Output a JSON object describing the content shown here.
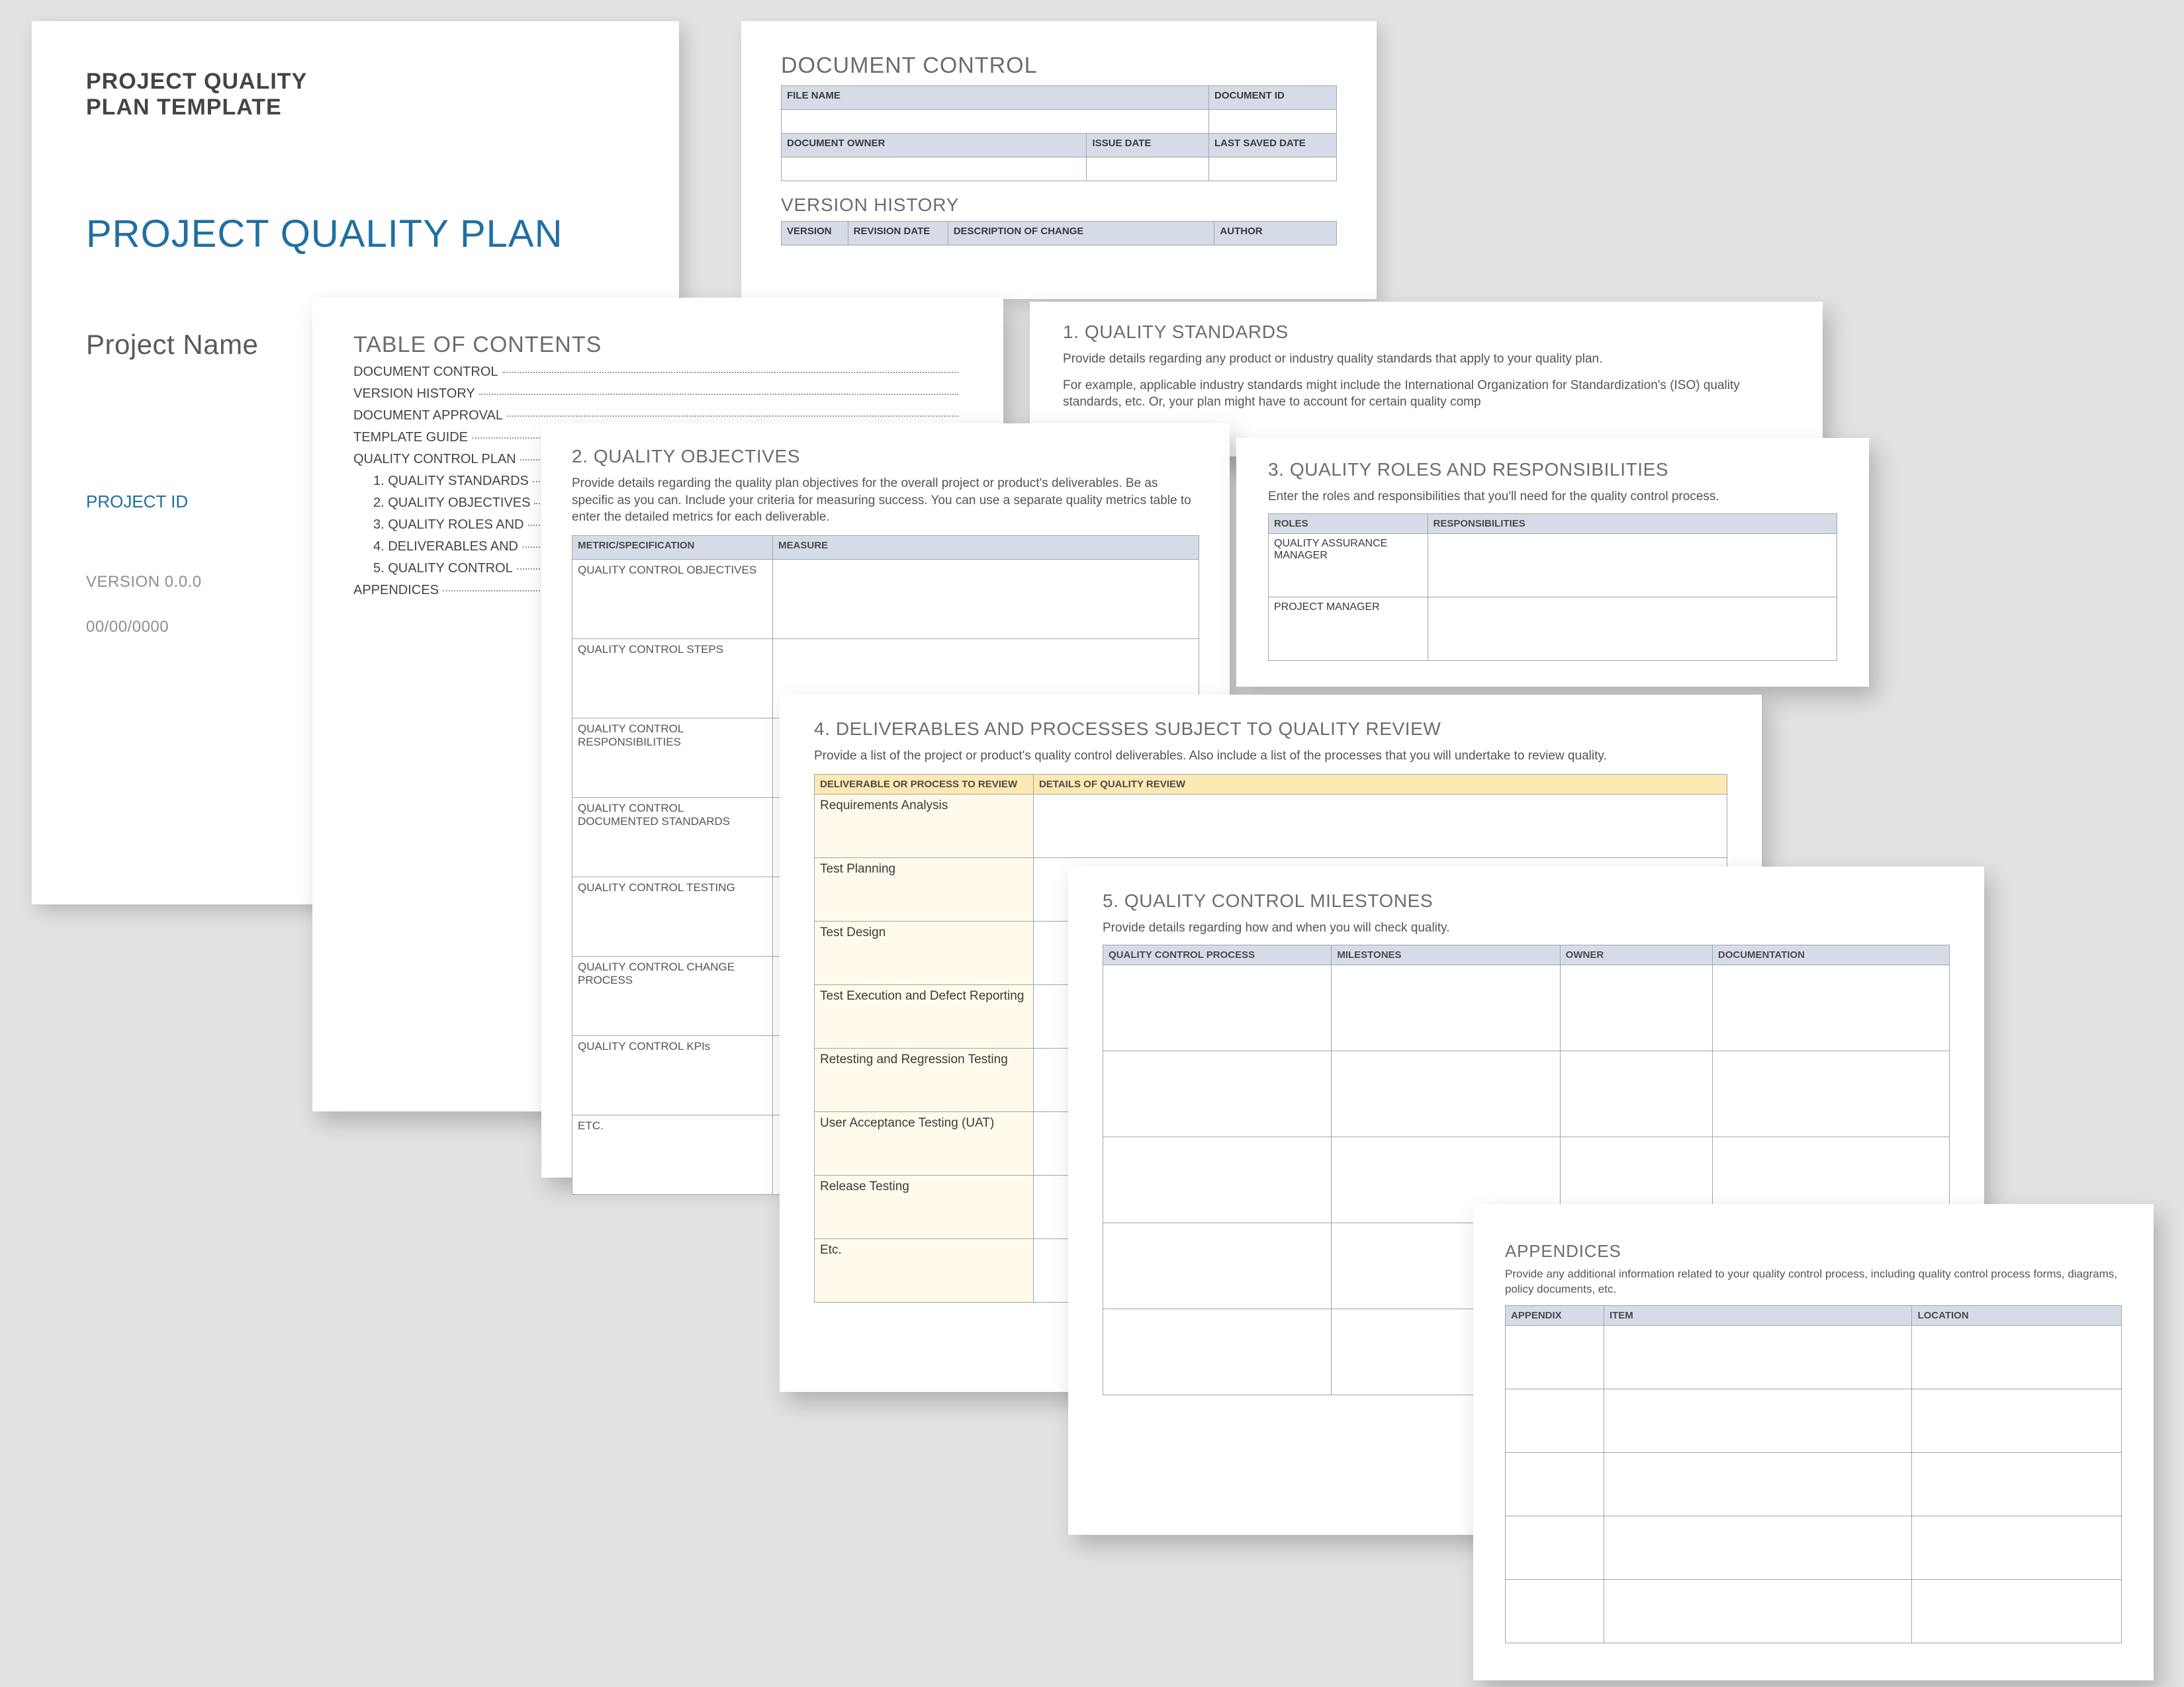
{
  "cover": {
    "kicker1": "PROJECT QUALITY",
    "kicker2": "PLAN TEMPLATE",
    "title": "PROJECT QUALITY PLAN",
    "project": "Project Name",
    "project_id": "PROJECT ID",
    "version": "VERSION 0.0.0",
    "date": "00/00/0000"
  },
  "doc_control": {
    "heading": "DOCUMENT CONTROL",
    "file_name": "FILE NAME",
    "document_id": "DOCUMENT ID",
    "document_owner": "DOCUMENT OWNER",
    "issue_date": "ISSUE DATE",
    "last_saved": "LAST SAVED DATE",
    "vh_heading": "VERSION HISTORY",
    "vh_cols": {
      "version": "VERSION",
      "rev": "REVISION DATE",
      "desc": "DESCRIPTION OF CHANGE",
      "author": "AUTHOR"
    }
  },
  "toc": {
    "heading": "TABLE OF CONTENTS",
    "items": [
      "DOCUMENT CONTROL",
      "VERSION HISTORY",
      "DOCUMENT APPROVAL",
      "TEMPLATE GUIDE",
      "QUALITY CONTROL PLAN",
      "1.   QUALITY STANDARDS",
      "2.   QUALITY OBJECTIVES",
      "3.   QUALITY ROLES AND",
      "4.   DELIVERABLES AND",
      "5.   QUALITY CONTROL",
      "APPENDICES"
    ],
    "indented": [
      5,
      6,
      7,
      8,
      9
    ]
  },
  "standards": {
    "heading": "1.  QUALITY STANDARDS",
    "body1": "Provide details regarding any product or industry quality standards that apply to your quality plan.",
    "body2": "For example, applicable industry standards might include the International Organization for Standardization's (ISO) quality standards, etc. Or, your plan might have to account for certain quality comp"
  },
  "objectives": {
    "heading": "2.  QUALITY OBJECTIVES",
    "intro": "Provide details regarding the quality plan objectives for the overall project or product's deliverables. Be as specific as you can. Include your criteria for measuring success. You can use a separate quality metrics table to enter the detailed metrics for each deliverable.",
    "col1": "METRIC/SPECIFICATION",
    "col2": "MEASURE",
    "rows": [
      "QUALITY CONTROL OBJECTIVES",
      "QUALITY CONTROL STEPS",
      "QUALITY CONTROL RESPONSIBILITIES",
      "QUALITY CONTROL DOCUMENTED STANDARDS",
      "QUALITY CONTROL TESTING",
      "QUALITY CONTROL CHANGE PROCESS",
      "QUALITY CONTROL KPIs",
      "ETC."
    ]
  },
  "roles": {
    "heading": "3.  QUALITY ROLES AND RESPONSIBILITIES",
    "intro": "Enter the roles and responsibilities that you'll need for the quality control process.",
    "col1": "ROLES",
    "col2": "RESPONSIBILITIES",
    "rows": [
      "QUALITY ASSURANCE MANAGER",
      "PROJECT MANAGER"
    ]
  },
  "deliverables": {
    "heading": "4.   DELIVERABLES AND PROCESSES SUBJECT TO QUALITY REVIEW",
    "intro": "Provide a list of the project or product's quality control deliverables. Also include a list of the processes that you will undertake to review quality.",
    "col1": "DELIVERABLE OR PROCESS TO REVIEW",
    "col2": "DETAILS OF QUALITY REVIEW",
    "rows": [
      "Requirements Analysis",
      "Test Planning",
      "Test Design",
      "Test Execution and Defect Reporting",
      "Retesting and Regression Testing",
      "User Acceptance Testing (UAT)",
      "Release Testing",
      "Etc."
    ]
  },
  "milestones": {
    "heading": "5.  QUALITY CONTROL MILESTONES",
    "intro": "Provide details regarding how and when you will check quality.",
    "cols": {
      "c1": "QUALITY CONTROL PROCESS",
      "c2": "MILESTONES",
      "c3": "OWNER",
      "c4": "DOCUMENTATION"
    }
  },
  "appendices": {
    "heading": "APPENDICES",
    "intro": "Provide any additional information related to your quality control process, including quality control process forms, diagrams, policy documents, etc.",
    "cols": {
      "c1": "APPENDIX",
      "c2": "ITEM",
      "c3": "LOCATION"
    }
  }
}
